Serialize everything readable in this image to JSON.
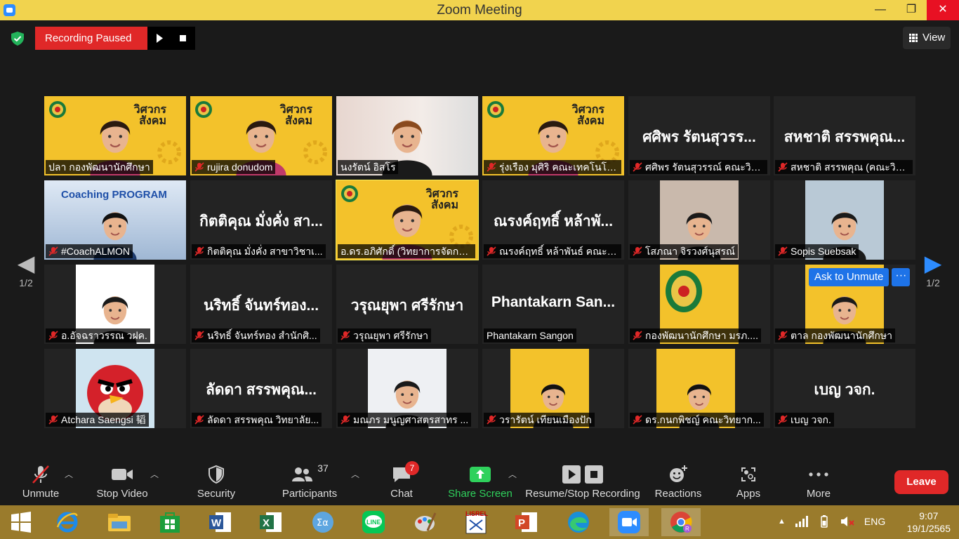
{
  "window": {
    "title": "Zoom Meeting",
    "minimize": "—",
    "maximize": "❐",
    "close": "✕"
  },
  "recording": {
    "status": "Recording Paused"
  },
  "view": {
    "label": "View"
  },
  "pager": {
    "left": "1/2",
    "right": "1/2"
  },
  "ask_unmute": {
    "label": "Ask to Unmute",
    "more": "···"
  },
  "tiles": [
    {
      "name": "ปลา กองพัฒนานักศึกษา",
      "muted": false,
      "video": true
    },
    {
      "name": "rujira donudom",
      "muted": true,
      "video": true
    },
    {
      "name": "นงรัตน์ อิสโร",
      "muted": false,
      "video": true
    },
    {
      "name": "รุ่งเรือง มุศิริ คณะเทคโนโลย...",
      "muted": true,
      "video": true
    },
    {
      "name": "ศศิพร รัตนสุวรรณ์ คณะวิท...",
      "display": "ศศิพร รัตนสุวรร...",
      "muted": true,
      "video": false
    },
    {
      "name": "สหชาติ สรรพคุณ (คณะวิท...",
      "display": "สหชาติ สรรพคุณ...",
      "muted": true,
      "video": false
    },
    {
      "name": "#CoachALMON",
      "muted": true,
      "video": true
    },
    {
      "name": "กิตติคุณ มั่งคั่ง สาขาวิชาเ...",
      "display": "กิตติคุณ มั่งคั่ง สา...",
      "muted": true,
      "video": false
    },
    {
      "name": "อ.ดร.อภิศักดิ์ (วิทยาการจัดการ)",
      "muted": false,
      "video": true
    },
    {
      "name": "ณรงค์ฤทธิ์ หล้าพันธ์ คณะว...",
      "display": "ณรงค์ฤทธิ์ หล้าพั...",
      "muted": true,
      "video": false
    },
    {
      "name": "โสภณา จิรวงศ์นุสรณ์",
      "muted": true,
      "video": true
    },
    {
      "name": "Sopis Suebsak",
      "muted": true,
      "video": true
    },
    {
      "name": "อ.อัจฉราวรรณ วฝค.",
      "muted": true,
      "video": true
    },
    {
      "name": "นริทธิ์ จันทร์ทอง สำนักศิ...",
      "display": "นริทธิ์ จันทร์ทอง...",
      "muted": true,
      "video": false
    },
    {
      "name": "วรุณยุพา ศรีรักษา",
      "display": "วรุณยุพา ศรีรักษา",
      "muted": true,
      "video": false
    },
    {
      "name": "Phantakarn Sangon",
      "display": "Phantakarn San...",
      "muted": false,
      "video": false
    },
    {
      "name": "กองพัฒนานักศึกษา มรภ....",
      "muted": true,
      "video": true
    },
    {
      "name": "ตาล กองพัฒนานักศึกษา",
      "muted": true,
      "video": true
    },
    {
      "name": "Atchara Saengsi 韬",
      "muted": true,
      "video": true
    },
    {
      "name": "ลัดดา สรรพคุณ วิทยาลัย...",
      "display": "ลัดดา สรรพคุณ...",
      "muted": true,
      "video": false
    },
    {
      "name": "มณภร มนูญศาสตรสาทร ...",
      "muted": true,
      "video": true
    },
    {
      "name": "วรารัตน์ เทียนเมืองปัก",
      "muted": true,
      "video": true
    },
    {
      "name": "ดร.กนกพิชญ์ คณะวิทยาก...",
      "muted": true,
      "video": true
    },
    {
      "name": "เบญ วจก.",
      "display": "เบญ วจก.",
      "muted": true,
      "video": false
    }
  ],
  "slide_text": {
    "line1": "วิศวกร",
    "line2": "สังคม",
    "coaching": "Coaching PROGRAM"
  },
  "toolbar": {
    "unmute": "Unmute",
    "stop_video": "Stop Video",
    "security": "Security",
    "participants": "Participants",
    "participants_count": "37",
    "chat": "Chat",
    "chat_badge": "7",
    "share": "Share Screen",
    "recording": "Resume/Stop Recording",
    "reactions": "Reactions",
    "apps": "Apps",
    "more": "More",
    "leave": "Leave"
  },
  "taskbar": {
    "lang": "ENG",
    "time": "9:07",
    "date": "19/1/2565"
  },
  "colors": {
    "title_bar": "#f1d34e",
    "record": "#e02828",
    "share": "#2fd15c",
    "active_speaker": "#f8ef5a",
    "ask_unmute": "#1e73e8",
    "taskbar": "#9a7b2c"
  }
}
